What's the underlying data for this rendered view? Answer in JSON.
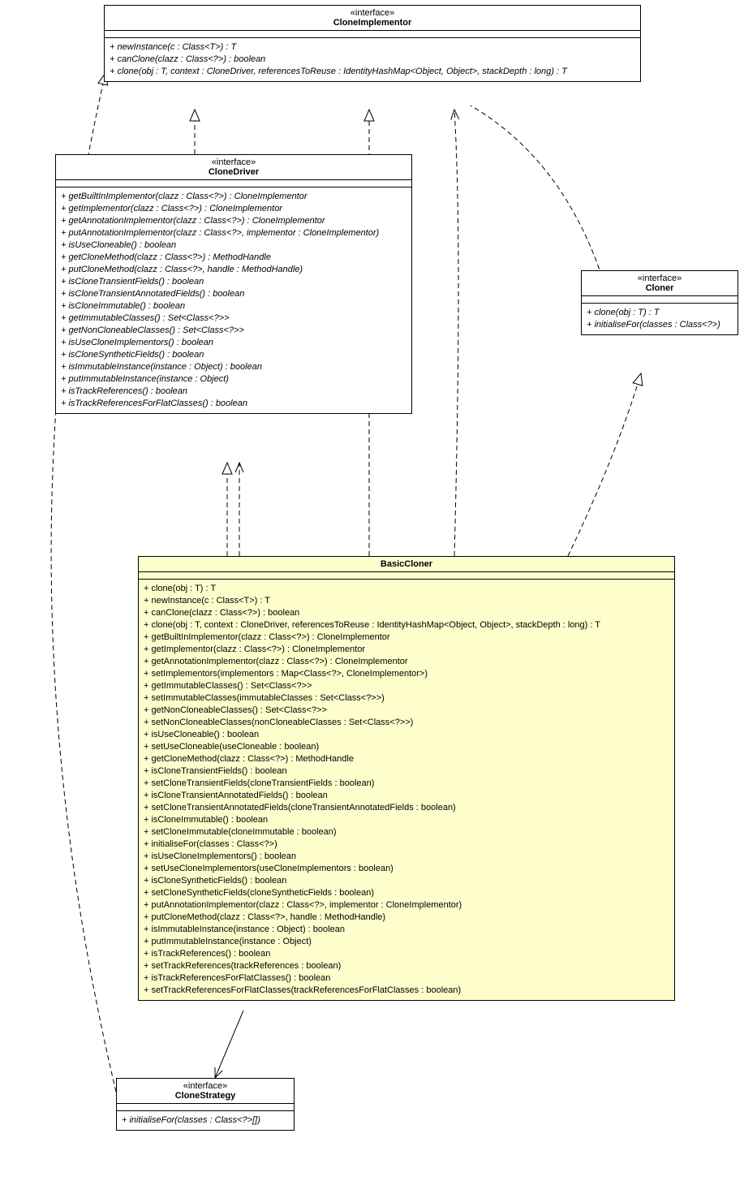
{
  "cloneImplementor": {
    "stereotype": "«interface»",
    "name": "CloneImplementor",
    "ops": [
      "+ newInstance(c : Class<T>) : T",
      "+ canClone(clazz : Class<?>) : boolean",
      "+ clone(obj : T, context : CloneDriver, referencesToReuse : IdentityHashMap<Object, Object>, stackDepth : long) : T"
    ]
  },
  "cloneDriver": {
    "stereotype": "«interface»",
    "name": "CloneDriver",
    "ops": [
      "+ getBuiltInImplementor(clazz : Class<?>) : CloneImplementor",
      "+ getImplementor(clazz : Class<?>) : CloneImplementor",
      "+ getAnnotationImplementor(clazz : Class<?>) : CloneImplementor",
      "+ putAnnotationImplementor(clazz : Class<?>, implementor : CloneImplementor)",
      "+ isUseCloneable() : boolean",
      "+ getCloneMethod(clazz : Class<?>) : MethodHandle",
      "+ putCloneMethod(clazz : Class<?>, handle : MethodHandle)",
      "+ isCloneTransientFields() : boolean",
      "+ isCloneTransientAnnotatedFields() : boolean",
      "+ isCloneImmutable() : boolean",
      "+ getImmutableClasses() : Set<Class<?>>",
      "+ getNonCloneableClasses() : Set<Class<?>>",
      "+ isUseCloneImplementors() : boolean",
      "+ isCloneSyntheticFields() : boolean",
      "+ isImmutableInstance(instance : Object) : boolean",
      "+ putImmutableInstance(instance : Object)",
      "+ isTrackReferences() : boolean",
      "+ isTrackReferencesForFlatClasses() : boolean"
    ]
  },
  "cloner": {
    "stereotype": "«interface»",
    "name": "Cloner",
    "ops": [
      "+ clone(obj : T) : T",
      "+ initialiseFor(classes : Class<?>)"
    ]
  },
  "basicCloner": {
    "name": "BasicCloner",
    "ops": [
      "+ clone(obj : T) : T",
      "+ newInstance(c : Class<T>) : T",
      "+ canClone(clazz : Class<?>) : boolean",
      "+ clone(obj : T, context : CloneDriver, referencesToReuse : IdentityHashMap<Object, Object>, stackDepth : long) : T",
      "+ getBuiltInImplementor(clazz : Class<?>) : CloneImplementor",
      "+ getImplementor(clazz : Class<?>) : CloneImplementor",
      "+ getAnnotationImplementor(clazz : Class<?>) : CloneImplementor",
      "+ setImplementors(implementors : Map<Class<?>, CloneImplementor>)",
      "+ getImmutableClasses() : Set<Class<?>>",
      "+ setImmutableClasses(immutableClasses : Set<Class<?>>)",
      "+ getNonCloneableClasses() : Set<Class<?>>",
      "+ setNonCloneableClasses(nonCloneableClasses : Set<Class<?>>)",
      "+ isUseCloneable() : boolean",
      "+ setUseCloneable(useCloneable : boolean)",
      "+ getCloneMethod(clazz : Class<?>) : MethodHandle",
      "+ isCloneTransientFields() : boolean",
      "+ setCloneTransientFields(cloneTransientFields : boolean)",
      "+ isCloneTransientAnnotatedFields() : boolean",
      "+ setCloneTransientAnnotatedFields(cloneTransientAnnotatedFields : boolean)",
      "+ isCloneImmutable() : boolean",
      "+ setCloneImmutable(cloneImmutable : boolean)",
      "+ initialiseFor(classes : Class<?>)",
      "+ isUseCloneImplementors() : boolean",
      "+ setUseCloneImplementors(useCloneImplementors : boolean)",
      "+ isCloneSyntheticFields() : boolean",
      "+ setCloneSyntheticFields(cloneSyntheticFields : boolean)",
      "+ putAnnotationImplementor(clazz : Class<?>, implementor : CloneImplementor)",
      "+ putCloneMethod(clazz : Class<?>, handle : MethodHandle)",
      "+ isImmutableInstance(instance : Object) : boolean",
      "+ putImmutableInstance(instance : Object)",
      "+ isTrackReferences() : boolean",
      "+ setTrackReferences(trackReferences : boolean)",
      "+ isTrackReferencesForFlatClasses() : boolean",
      "+ setTrackReferencesForFlatClasses(trackReferencesForFlatClasses : boolean)"
    ]
  },
  "cloneStrategy": {
    "stereotype": "«interface»",
    "name": "CloneStrategy",
    "ops": [
      "+ initialiseFor(classes : Class<?>[])"
    ]
  }
}
